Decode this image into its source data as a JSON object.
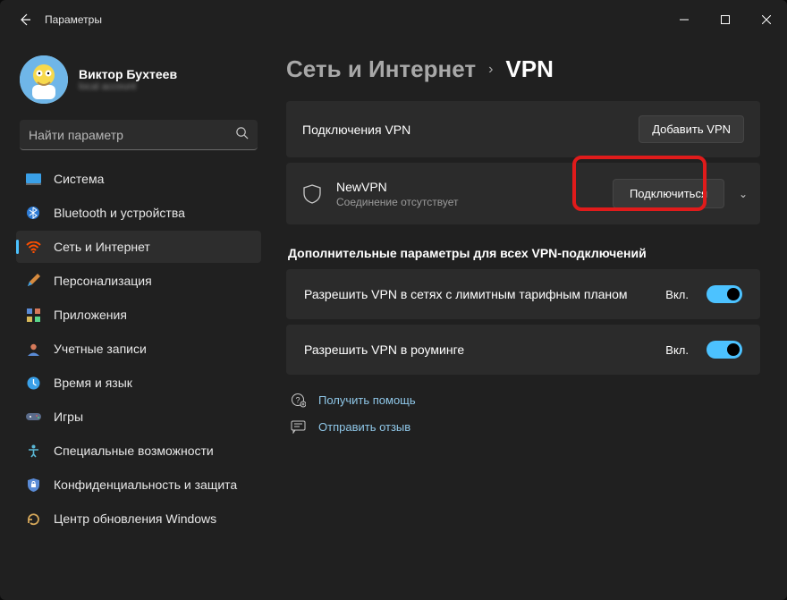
{
  "app_title": "Параметры",
  "profile": {
    "name": "Виктор Бухтеев",
    "sub": "local account"
  },
  "search": {
    "placeholder": "Найти параметр"
  },
  "nav": [
    {
      "label": "Система"
    },
    {
      "label": "Bluetooth и устройства"
    },
    {
      "label": "Сеть и Интернет"
    },
    {
      "label": "Персонализация"
    },
    {
      "label": "Приложения"
    },
    {
      "label": "Учетные записи"
    },
    {
      "label": "Время и язык"
    },
    {
      "label": "Игры"
    },
    {
      "label": "Специальные возможности"
    },
    {
      "label": "Конфиденциальность и защита"
    },
    {
      "label": "Центр обновления Windows"
    }
  ],
  "breadcrumb": {
    "parent": "Сеть и Интернет",
    "current": "VPN"
  },
  "vpn_connections": {
    "title": "Подключения VPN",
    "add_button": "Добавить VPN"
  },
  "vpn_entry": {
    "name": "NewVPN",
    "status": "Соединение отсутствует",
    "connect_button": "Подключиться"
  },
  "section_header": "Дополнительные параметры для всех VPN-подключений",
  "toggles": [
    {
      "label": "Разрешить VPN в сетях с лимитным тарифным планом",
      "state": "Вкл."
    },
    {
      "label": "Разрешить VPN в роуминге",
      "state": "Вкл."
    }
  ],
  "footer": {
    "help": "Получить помощь",
    "feedback": "Отправить отзыв"
  }
}
